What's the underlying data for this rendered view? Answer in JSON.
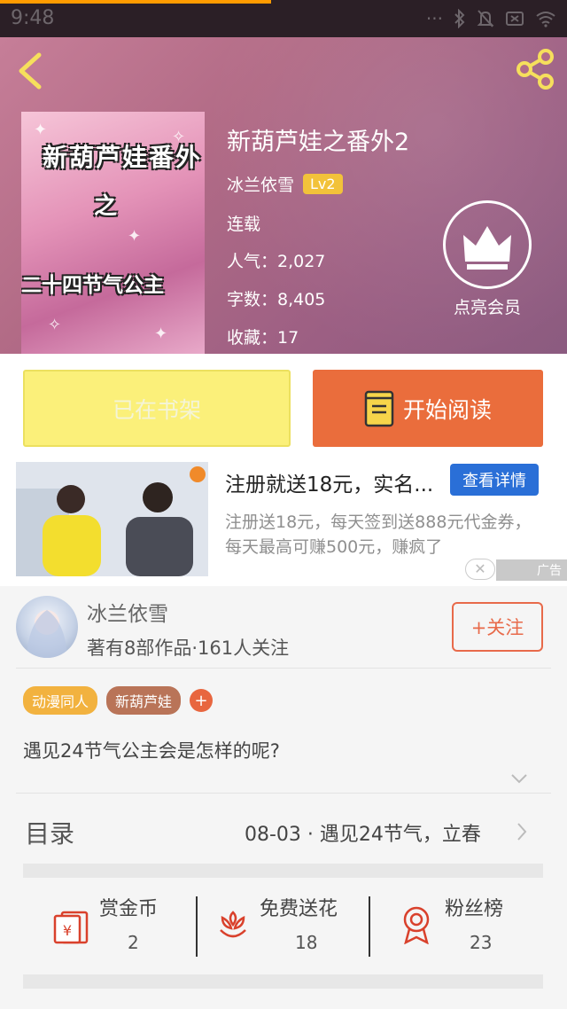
{
  "status_bar": {
    "time": "9:48",
    "icons": [
      "dots-icon",
      "bluetooth-icon",
      "mute-icon",
      "sim-icon",
      "wifi-icon"
    ]
  },
  "book": {
    "title": "新葫芦娃之番外2",
    "author": "冰兰依雪",
    "level": "Lv2",
    "status": "连载",
    "popularity": "人气：2,027",
    "word_count": "字数：8,405",
    "favorites": "收藏：17",
    "cover": {
      "title_line": "新葫芦娃番外",
      "middle": "之",
      "subtitle": "二十四节气公主"
    }
  },
  "header": {
    "vip_label": "点亮会员"
  },
  "actions": {
    "shelf_label": "已在书架",
    "read_label": "开始阅读"
  },
  "ad": {
    "title": "注册就送18元，实名...",
    "cta": "查看详情",
    "description": "注册送18元，每天签到送888元代金券，每天最高可赚500元，赚疯了",
    "tag": "广告",
    "close": "✕"
  },
  "author_card": {
    "name": "冰兰依雪",
    "stats": "著有8部作品·161人关注",
    "follow_label": "+关注"
  },
  "tags": [
    "动漫同人",
    "新葫芦娃"
  ],
  "tag_add": "+",
  "summary": "遇见24节气公主会是怎样的呢?",
  "toc": {
    "label": "目录",
    "latest": "08-03 · 遇见24节气，立春"
  },
  "stats": [
    {
      "label": "赏金币",
      "value": "2",
      "icon": "red-envelope-icon"
    },
    {
      "label": "免费送花",
      "value": "18",
      "icon": "flower-icon"
    },
    {
      "label": "粉丝榜",
      "value": "23",
      "icon": "medal-icon"
    }
  ],
  "colors": {
    "accent": "#ea6d3c",
    "shelf_button": "#fbf07a",
    "level_badge": "#f2c23a",
    "ad_button": "#2a6fd7",
    "icon_red": "#d9412c"
  }
}
